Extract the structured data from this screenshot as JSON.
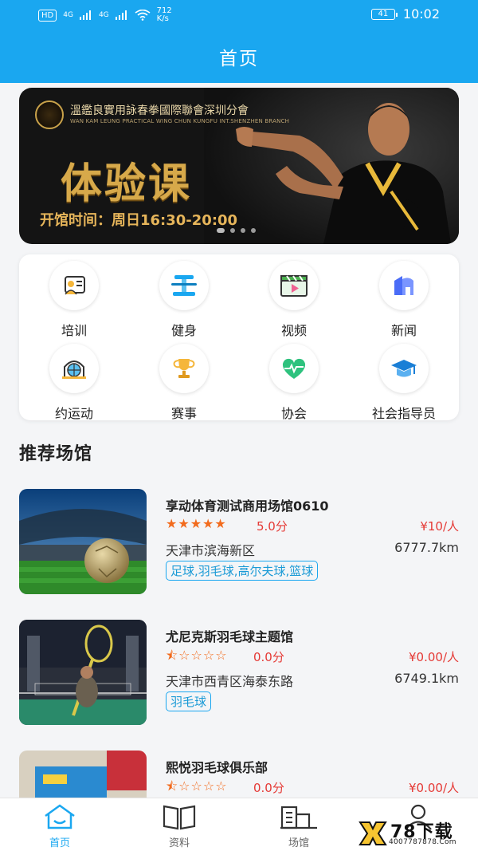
{
  "status_bar": {
    "hd": "HD",
    "net1": "4G",
    "net2": "4G",
    "speed": "712",
    "speed_unit": "K/s",
    "battery": "41",
    "time": "10:02"
  },
  "navbar": {
    "title": "首页"
  },
  "banner": {
    "brand": "溫鑑良實用詠春拳國際聯會深圳分會",
    "brand_sub": "WAN KAM LEUNG PRACTICAL WING CHUN KUNGFU INT.SHENZHEN BRANCH",
    "headline": "体验课",
    "hours": "开馆时间：周日16:30-20:00",
    "page_count": 4,
    "active_page": 1
  },
  "categories": [
    {
      "label": "培训",
      "icon": "training-icon"
    },
    {
      "label": "健身",
      "icon": "fitness-icon"
    },
    {
      "label": "视频",
      "icon": "video-icon"
    },
    {
      "label": "新闻",
      "icon": "news-icon"
    },
    {
      "label": "约运动",
      "icon": "sports-appointment-icon"
    },
    {
      "label": "赛事",
      "icon": "trophy-icon"
    },
    {
      "label": "协会",
      "icon": "heart-icon"
    },
    {
      "label": "社会指导员",
      "icon": "graduation-cap-icon"
    }
  ],
  "recommend": {
    "title": "推荐场馆",
    "venues": [
      {
        "name": "享动体育测试商用场馆0610",
        "rating": 5,
        "score": "5.0分",
        "price": "¥10/人",
        "address": "天津市滨海新区",
        "distance": "6777.7km",
        "tags": "足球,羽毛球,高尔夫球,篮球",
        "image": "soccer-stadium-photo"
      },
      {
        "name": "尤尼克斯羽毛球主题馆",
        "rating": 0.5,
        "score": "0.0分",
        "price": "¥0.00/人",
        "address": "天津市西青区海泰东路",
        "distance": "6749.1km",
        "tags": "羽毛球",
        "image": "badminton-hall-photo"
      },
      {
        "name": "熙悦羽毛球俱乐部",
        "rating": 0.5,
        "score": "0.0分",
        "price": "¥0.00/人",
        "image": "badminton-club-photo"
      }
    ]
  },
  "tabbar": [
    {
      "label": "首页",
      "icon": "home-icon",
      "active": true
    },
    {
      "label": "资料",
      "icon": "book-icon",
      "active": false
    },
    {
      "label": "场馆",
      "icon": "venue-icon",
      "active": false
    },
    {
      "label": "我的",
      "icon": "user-icon",
      "active": false
    }
  ],
  "watermark": {
    "text": "78下载",
    "url": "4007787878.Com"
  },
  "colors": {
    "primary": "#1aa7f0",
    "price": "#e53935",
    "star": "#f26b1d"
  }
}
